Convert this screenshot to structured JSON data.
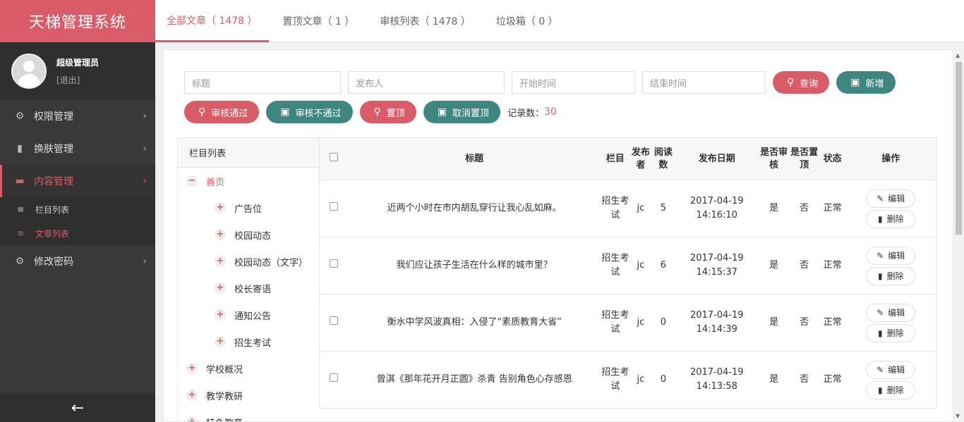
{
  "app": {
    "title": "天梯管理系统"
  },
  "user": {
    "name": "超级管理员",
    "logout": "[退出]"
  },
  "sidebar": {
    "items": [
      {
        "label": "权限管理",
        "icon": "gear-icon"
      },
      {
        "label": "换肤管理",
        "icon": "skin-icon"
      },
      {
        "label": "内容管理",
        "icon": "content-icon"
      },
      {
        "label": "修改密码",
        "icon": "gear-icon"
      }
    ],
    "subitems": [
      {
        "label": "栏目列表"
      },
      {
        "label": "文章列表"
      }
    ],
    "back_icon": "←"
  },
  "tabs": [
    {
      "label": "全部文章（ 1478 ）"
    },
    {
      "label": "置顶文章（ 1 ）"
    },
    {
      "label": "审核列表（ 1478 ）"
    },
    {
      "label": "垃圾箱（ 0 ）"
    }
  ],
  "search": {
    "title_placeholder": "标题",
    "author_placeholder": "发布人",
    "start_placeholder": "开始时间",
    "end_placeholder": "结束时间",
    "query_label": "查询",
    "add_label": "新增"
  },
  "actions": {
    "approve_label": "审核通过",
    "reject_label": "审核不通过",
    "pin_label": "置顶",
    "unpin_label": "取消置顶",
    "count_label": "记录数：",
    "count_value": "30"
  },
  "tree": {
    "header": "栏目列表",
    "nodes": [
      {
        "label": "首页",
        "toggle": "−"
      },
      {
        "label": "广告位",
        "toggle": "+"
      },
      {
        "label": "校园动态",
        "toggle": "+"
      },
      {
        "label": "校园动态（文字）",
        "toggle": "+"
      },
      {
        "label": "校长寄语",
        "toggle": "+"
      },
      {
        "label": "通知公告",
        "toggle": "+"
      },
      {
        "label": "招生考试",
        "toggle": "+"
      },
      {
        "label": "学校概况",
        "toggle": "+"
      },
      {
        "label": "教学教研",
        "toggle": "+"
      },
      {
        "label": "特色教育",
        "toggle": "+"
      }
    ]
  },
  "table": {
    "headers": {
      "title": "标题",
      "column": "栏目",
      "author": "发布者",
      "reads": "阅读数",
      "date": "发布日期",
      "reviewed": "是否审核",
      "pinned": "是否置顶",
      "status": "状态",
      "ops": "操作"
    },
    "rows": [
      {
        "title": "近两个小时在市内胡乱穿行让我心乱如麻。",
        "column": "招生考试",
        "author": "jc",
        "reads": "5",
        "date": "2017-04-19",
        "time": "14:16:10",
        "reviewed": "是",
        "pinned": "否",
        "status": "正常"
      },
      {
        "title": "我们应让孩子生活在什么样的城市里？",
        "column": "招生考试",
        "author": "jc",
        "reads": "6",
        "date": "2017-04-19",
        "time": "14:15:37",
        "reviewed": "是",
        "pinned": "否",
        "status": "正常"
      },
      {
        "title": "衡水中学风波真相：入侵了“素质教育大省”",
        "column": "招生考试",
        "author": "jc",
        "reads": "0",
        "date": "2017-04-19",
        "time": "14:14:39",
        "reviewed": "是",
        "pinned": "否",
        "status": "正常"
      },
      {
        "title": "曾淇《那年花开月正圆》杀青 告别角色心存感恩",
        "column": "招生考试",
        "author": "jc",
        "reads": "0",
        "date": "2017-04-19",
        "time": "14:13:58",
        "reviewed": "是",
        "pinned": "否",
        "status": "正常"
      }
    ],
    "edit_label": "编辑",
    "delete_label": "删除"
  },
  "colors": {
    "accent": "#d95c68",
    "teal": "#3e8781",
    "sidebar": "#393939"
  }
}
